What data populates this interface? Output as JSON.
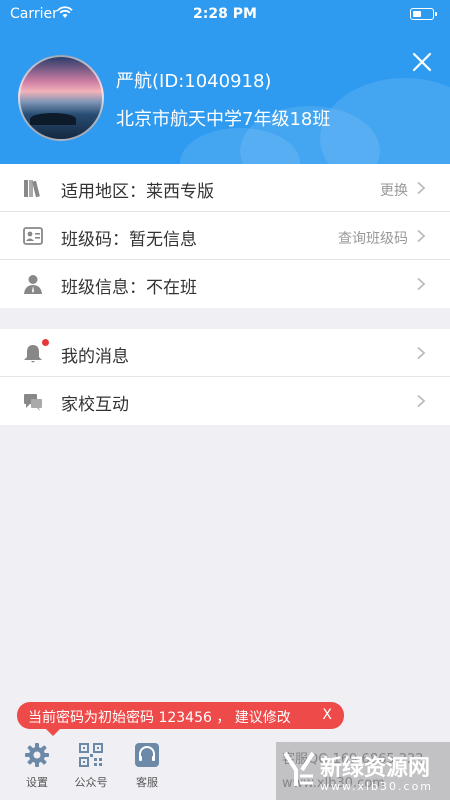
{
  "status_bar": {
    "carrier": "Carrier",
    "time": "2:28 PM"
  },
  "profile": {
    "name": "严航(ID:1040918)",
    "school": "北京市航天中学7年级18班"
  },
  "section1": [
    {
      "label": "适用地区：莱西专版",
      "action": "更换",
      "icon": "books-icon"
    },
    {
      "label": "班级码：暂无信息",
      "action": "查询班级码",
      "icon": "class-code-icon"
    },
    {
      "label": "班级信息：不在班",
      "action": "",
      "icon": "person-icon"
    }
  ],
  "section2": [
    {
      "label": "我的消息",
      "icon": "bell-icon",
      "badge": true
    },
    {
      "label": "家校互动",
      "icon": "chat-icon"
    }
  ],
  "toast": {
    "message": "当前密码为初始密码 123456 ， 建议修改",
    "close": "X"
  },
  "tabs": [
    {
      "label": "设置",
      "icon": "gear-icon"
    },
    {
      "label": "公众号",
      "icon": "qr-code-icon"
    },
    {
      "label": "客服",
      "icon": "headset-icon"
    }
  ],
  "watermark": {
    "title": "新绿资源网",
    "url": "www.xlb30.com",
    "faint_line1": "客服QQ 169 6865 222",
    "faint_line2": "www.xlb30.com"
  },
  "colors": {
    "primary": "#2f9bf0",
    "toast": "#ef4a4a",
    "badge": "#e53935"
  }
}
